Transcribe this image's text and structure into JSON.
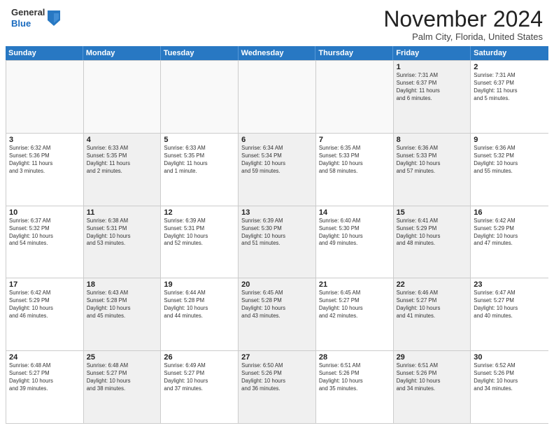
{
  "header": {
    "logo": {
      "line1": "General",
      "line2": "Blue"
    },
    "title": "November 2024",
    "location": "Palm City, Florida, United States"
  },
  "weekdays": [
    "Sunday",
    "Monday",
    "Tuesday",
    "Wednesday",
    "Thursday",
    "Friday",
    "Saturday"
  ],
  "weeks": [
    [
      {
        "day": "",
        "empty": true,
        "info": ""
      },
      {
        "day": "",
        "empty": true,
        "info": ""
      },
      {
        "day": "",
        "empty": true,
        "info": ""
      },
      {
        "day": "",
        "empty": true,
        "info": ""
      },
      {
        "day": "",
        "empty": true,
        "info": ""
      },
      {
        "day": "1",
        "empty": false,
        "shaded": true,
        "info": "Sunrise: 7:31 AM\nSunset: 6:37 PM\nDaylight: 11 hours\nand 6 minutes."
      },
      {
        "day": "2",
        "empty": false,
        "shaded": false,
        "info": "Sunrise: 7:31 AM\nSunset: 6:37 PM\nDaylight: 11 hours\nand 5 minutes."
      }
    ],
    [
      {
        "day": "3",
        "empty": false,
        "shaded": false,
        "info": "Sunrise: 6:32 AM\nSunset: 5:36 PM\nDaylight: 11 hours\nand 3 minutes."
      },
      {
        "day": "4",
        "empty": false,
        "shaded": true,
        "info": "Sunrise: 6:33 AM\nSunset: 5:35 PM\nDaylight: 11 hours\nand 2 minutes."
      },
      {
        "day": "5",
        "empty": false,
        "shaded": false,
        "info": "Sunrise: 6:33 AM\nSunset: 5:35 PM\nDaylight: 11 hours\nand 1 minute."
      },
      {
        "day": "6",
        "empty": false,
        "shaded": true,
        "info": "Sunrise: 6:34 AM\nSunset: 5:34 PM\nDaylight: 10 hours\nand 59 minutes."
      },
      {
        "day": "7",
        "empty": false,
        "shaded": false,
        "info": "Sunrise: 6:35 AM\nSunset: 5:33 PM\nDaylight: 10 hours\nand 58 minutes."
      },
      {
        "day": "8",
        "empty": false,
        "shaded": true,
        "info": "Sunrise: 6:36 AM\nSunset: 5:33 PM\nDaylight: 10 hours\nand 57 minutes."
      },
      {
        "day": "9",
        "empty": false,
        "shaded": false,
        "info": "Sunrise: 6:36 AM\nSunset: 5:32 PM\nDaylight: 10 hours\nand 55 minutes."
      }
    ],
    [
      {
        "day": "10",
        "empty": false,
        "shaded": false,
        "info": "Sunrise: 6:37 AM\nSunset: 5:32 PM\nDaylight: 10 hours\nand 54 minutes."
      },
      {
        "day": "11",
        "empty": false,
        "shaded": true,
        "info": "Sunrise: 6:38 AM\nSunset: 5:31 PM\nDaylight: 10 hours\nand 53 minutes."
      },
      {
        "day": "12",
        "empty": false,
        "shaded": false,
        "info": "Sunrise: 6:39 AM\nSunset: 5:31 PM\nDaylight: 10 hours\nand 52 minutes."
      },
      {
        "day": "13",
        "empty": false,
        "shaded": true,
        "info": "Sunrise: 6:39 AM\nSunset: 5:30 PM\nDaylight: 10 hours\nand 51 minutes."
      },
      {
        "day": "14",
        "empty": false,
        "shaded": false,
        "info": "Sunrise: 6:40 AM\nSunset: 5:30 PM\nDaylight: 10 hours\nand 49 minutes."
      },
      {
        "day": "15",
        "empty": false,
        "shaded": true,
        "info": "Sunrise: 6:41 AM\nSunset: 5:29 PM\nDaylight: 10 hours\nand 48 minutes."
      },
      {
        "day": "16",
        "empty": false,
        "shaded": false,
        "info": "Sunrise: 6:42 AM\nSunset: 5:29 PM\nDaylight: 10 hours\nand 47 minutes."
      }
    ],
    [
      {
        "day": "17",
        "empty": false,
        "shaded": false,
        "info": "Sunrise: 6:42 AM\nSunset: 5:29 PM\nDaylight: 10 hours\nand 46 minutes."
      },
      {
        "day": "18",
        "empty": false,
        "shaded": true,
        "info": "Sunrise: 6:43 AM\nSunset: 5:28 PM\nDaylight: 10 hours\nand 45 minutes."
      },
      {
        "day": "19",
        "empty": false,
        "shaded": false,
        "info": "Sunrise: 6:44 AM\nSunset: 5:28 PM\nDaylight: 10 hours\nand 44 minutes."
      },
      {
        "day": "20",
        "empty": false,
        "shaded": true,
        "info": "Sunrise: 6:45 AM\nSunset: 5:28 PM\nDaylight: 10 hours\nand 43 minutes."
      },
      {
        "day": "21",
        "empty": false,
        "shaded": false,
        "info": "Sunrise: 6:45 AM\nSunset: 5:27 PM\nDaylight: 10 hours\nand 42 minutes."
      },
      {
        "day": "22",
        "empty": false,
        "shaded": true,
        "info": "Sunrise: 6:46 AM\nSunset: 5:27 PM\nDaylight: 10 hours\nand 41 minutes."
      },
      {
        "day": "23",
        "empty": false,
        "shaded": false,
        "info": "Sunrise: 6:47 AM\nSunset: 5:27 PM\nDaylight: 10 hours\nand 40 minutes."
      }
    ],
    [
      {
        "day": "24",
        "empty": false,
        "shaded": false,
        "info": "Sunrise: 6:48 AM\nSunset: 5:27 PM\nDaylight: 10 hours\nand 39 minutes."
      },
      {
        "day": "25",
        "empty": false,
        "shaded": true,
        "info": "Sunrise: 6:48 AM\nSunset: 5:27 PM\nDaylight: 10 hours\nand 38 minutes."
      },
      {
        "day": "26",
        "empty": false,
        "shaded": false,
        "info": "Sunrise: 6:49 AM\nSunset: 5:27 PM\nDaylight: 10 hours\nand 37 minutes."
      },
      {
        "day": "27",
        "empty": false,
        "shaded": true,
        "info": "Sunrise: 6:50 AM\nSunset: 5:26 PM\nDaylight: 10 hours\nand 36 minutes."
      },
      {
        "day": "28",
        "empty": false,
        "shaded": false,
        "info": "Sunrise: 6:51 AM\nSunset: 5:26 PM\nDaylight: 10 hours\nand 35 minutes."
      },
      {
        "day": "29",
        "empty": false,
        "shaded": true,
        "info": "Sunrise: 6:51 AM\nSunset: 5:26 PM\nDaylight: 10 hours\nand 34 minutes."
      },
      {
        "day": "30",
        "empty": false,
        "shaded": false,
        "info": "Sunrise: 6:52 AM\nSunset: 5:26 PM\nDaylight: 10 hours\nand 34 minutes."
      }
    ]
  ]
}
